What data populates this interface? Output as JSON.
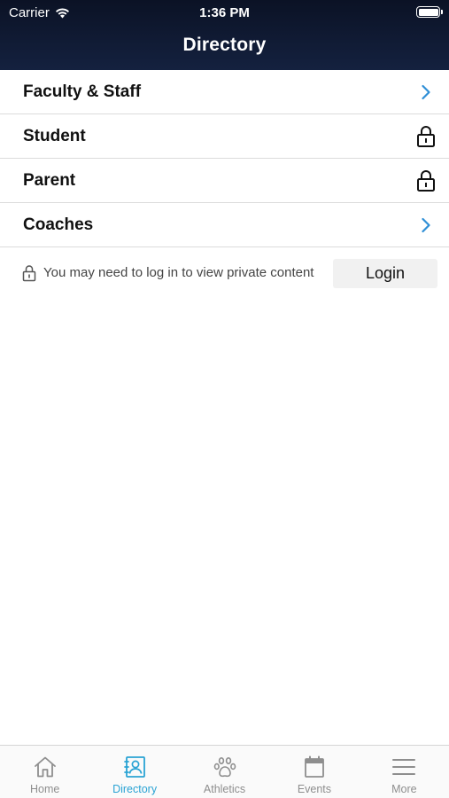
{
  "status_bar": {
    "carrier": "Carrier",
    "time": "1:36 PM"
  },
  "header": {
    "title": "Directory"
  },
  "list": {
    "items": [
      {
        "label": "Faculty & Staff",
        "icon": "chevron-right-icon"
      },
      {
        "label": "Student",
        "icon": "lock-icon"
      },
      {
        "label": "Parent",
        "icon": "lock-icon"
      },
      {
        "label": "Coaches",
        "icon": "chevron-right-icon"
      }
    ]
  },
  "notice": {
    "text": "You may need to log in to view private content",
    "login_label": "Login"
  },
  "tabbar": {
    "tabs": [
      {
        "label": "Home",
        "icon": "home-icon",
        "active": false
      },
      {
        "label": "Directory",
        "icon": "directory-icon",
        "active": true
      },
      {
        "label": "Athletics",
        "icon": "paw-icon",
        "active": false
      },
      {
        "label": "Events",
        "icon": "calendar-icon",
        "active": false
      },
      {
        "label": "More",
        "icon": "menu-icon",
        "active": false
      }
    ]
  },
  "colors": {
    "header_top": "#0b1225",
    "header_bottom": "#14213f",
    "accent": "#2aa3d4",
    "chevron": "#2f8fd6",
    "inactive_tab": "#8e8e8e"
  }
}
